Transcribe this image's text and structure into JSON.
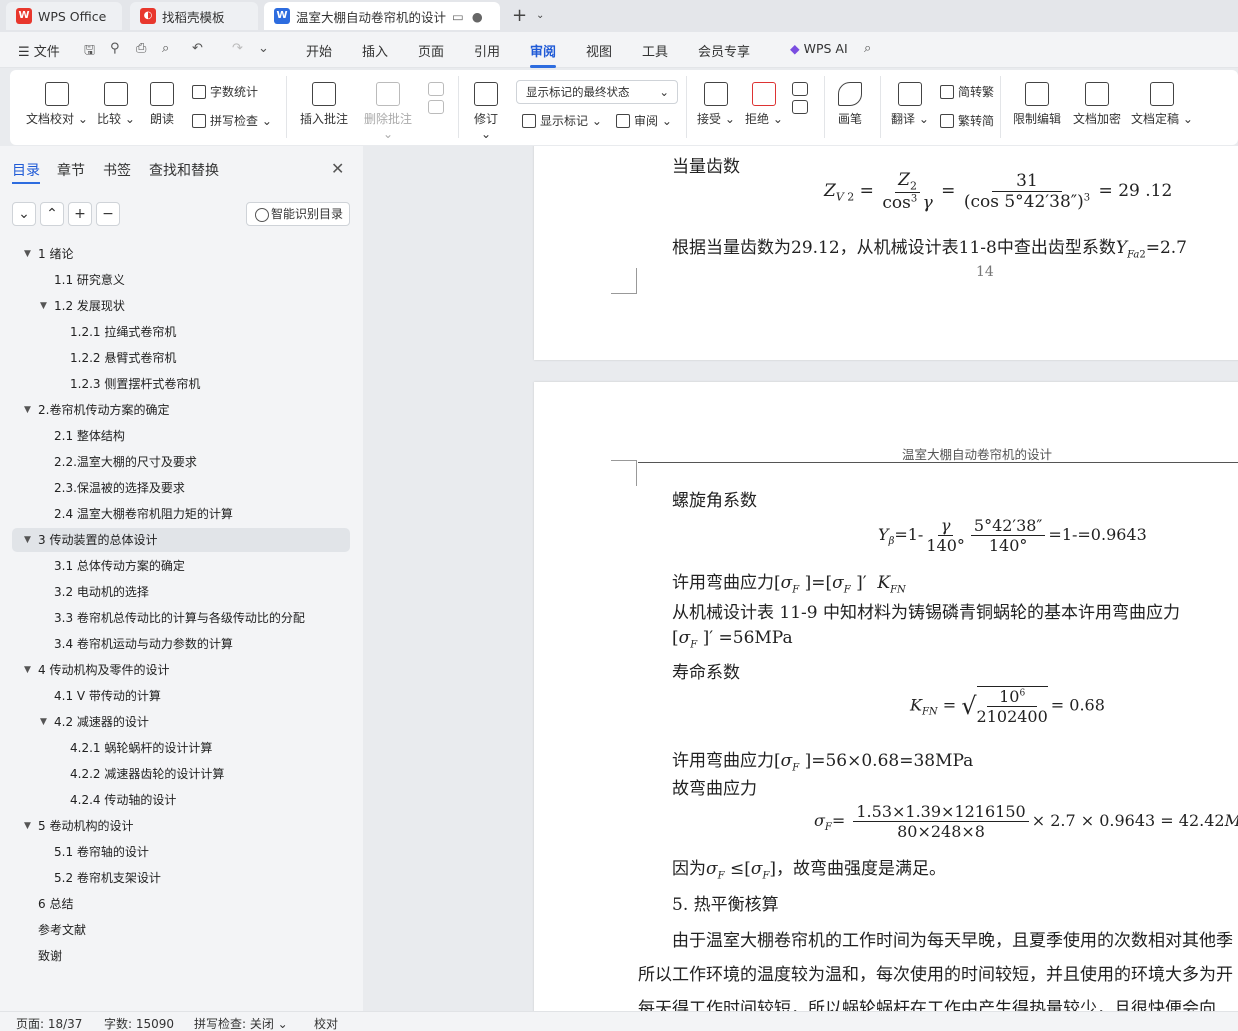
{
  "tabs": {
    "wps": "WPS Office",
    "template": "找稻壳模板",
    "doc": "温室大棚自动卷帘机的设计 毕"
  },
  "menu": {
    "file": "文件",
    "items": [
      "开始",
      "插入",
      "页面",
      "引用",
      "审阅",
      "视图",
      "工具",
      "会员专享"
    ],
    "ai": "WPS AI"
  },
  "ribbon": {
    "proofread": "文档校对",
    "compare": "比较",
    "read": "朗读",
    "wordcount": "字数统计",
    "spellcheck": "拼写检查",
    "insert_comment": "插入批注",
    "delete_comment": "删除批注",
    "revise": "修订",
    "display_state": "显示标记的最终状态",
    "show_marks": "显示标记",
    "review": "审阅",
    "accept": "接受",
    "reject": "拒绝",
    "pen": "画笔",
    "translate": "翻译",
    "to_trad": "简转繁",
    "to_simp": "繁转简",
    "restrict": "限制编辑",
    "encrypt": "文档加密",
    "finalize": "文档定稿"
  },
  "sidebar": {
    "tabs": [
      "目录",
      "章节",
      "书签",
      "查找和替换"
    ],
    "smart_toc": "智能识别目录",
    "toc": [
      {
        "label": "1  绪论",
        "level": 1,
        "toggle": "▼"
      },
      {
        "label": "1.1 研究意义",
        "level": 2
      },
      {
        "label": "1.2 发展现状",
        "level": 2,
        "toggle": "▼"
      },
      {
        "label": "1.2.1  拉绳式卷帘机",
        "level": 3
      },
      {
        "label": "1.2.2  悬臂式卷帘机",
        "level": 3
      },
      {
        "label": "1.2.3  侧置摆杆式卷帘机",
        "level": 3
      },
      {
        "label": "2.卷帘机传动方案的确定",
        "level": 1,
        "toggle": "▼"
      },
      {
        "label": "2.1 整体结构",
        "level": 2
      },
      {
        "label": "2.2.温室大棚的尺寸及要求",
        "level": 2
      },
      {
        "label": "2.3.保温被的选择及要求",
        "level": 2
      },
      {
        "label": "2.4 温室大棚卷帘机阻力矩的计算",
        "level": 2
      },
      {
        "label": "3 传动装置的总体设计",
        "level": 1,
        "toggle": "▼",
        "selected": true
      },
      {
        "label": "3.1 总体传动方案的确定",
        "level": 2
      },
      {
        "label": "3.2 电动机的选择",
        "level": 2
      },
      {
        "label": "3.3  卷帘机总传动比的计算与各级传动比的分配",
        "level": 2
      },
      {
        "label": "3.4  卷帘机运动与动力参数的计算",
        "level": 2
      },
      {
        "label": "4 传动机构及零件的设计",
        "level": 1,
        "toggle": "▼"
      },
      {
        "label": "4.1 V 带传动的计算",
        "level": 2
      },
      {
        "label": "4.2 减速器的设计",
        "level": 2,
        "toggle": "▼"
      },
      {
        "label": "4.2.1  蜗轮蜗杆的设计计算",
        "level": 3
      },
      {
        "label": "4.2.2 减速器齿轮的设计计算",
        "level": 3
      },
      {
        "label": "4.2.4  传动轴的设计",
        "level": 3
      },
      {
        "label": "5 卷动机构的设计",
        "level": 1,
        "toggle": "▼"
      },
      {
        "label": "5.1 卷帘轴的设计",
        "level": 2
      },
      {
        "label": "5.2 卷帘机支架设计",
        "level": 2
      },
      {
        "label": "6 总结",
        "level": 1
      },
      {
        "label": "参考文献",
        "level": 1
      },
      {
        "label": "致谢",
        "level": 1
      }
    ]
  },
  "doc": {
    "p1": {
      "l1": "当量齿数",
      "l2": "根据当量齿数为29.12，从机械设计表11-8中查出齿型系数",
      "yfa": "=2.7",
      "page_no": "14"
    },
    "p2": {
      "header": "温室大棚自动卷帘机的设计",
      "l1": "螺旋角系数",
      "eq1_rhs": "=1-=0.9643",
      "l2": "许用弯曲应力[σ",
      "l3": "从机械设计表 11-9 中知材料为铸锡磷青铜蜗轮的基本许用弯曲应力",
      "l4": "=56MPa",
      "l5": "寿命系数",
      "kfn_val": "= 0.68",
      "l6": "许用弯曲应力[σ",
      "l6b": " ]=56×0.68=38MPa",
      "l7": "故弯曲应力",
      "eq3_num": "1.53×1.39×1216150",
      "eq3_den": "80×248×8",
      "eq3_rhs": "× 2.7 × 0.9643 = 42.42",
      "l8a": "因为σ",
      "l8b": "，故弯曲强度是满足。",
      "l9": "5. 热平衡核算",
      "l10": "由于温室大棚卷帘机的工作时间为每天早晚，且夏季使用的次数相对其他季",
      "l11": "所以工作环境的温度较为温和，每次使用的时间较短，并且使用的环境大多为开",
      "l12": "每天得工作时间较短，所以蜗轮蜗杆在工作中产生得热量较少，且很快便会向"
    }
  },
  "status": {
    "page": "页面: 18/37",
    "words": "字数: 15090",
    "spell": "拼写检查: 关闭",
    "proof": "校对"
  }
}
